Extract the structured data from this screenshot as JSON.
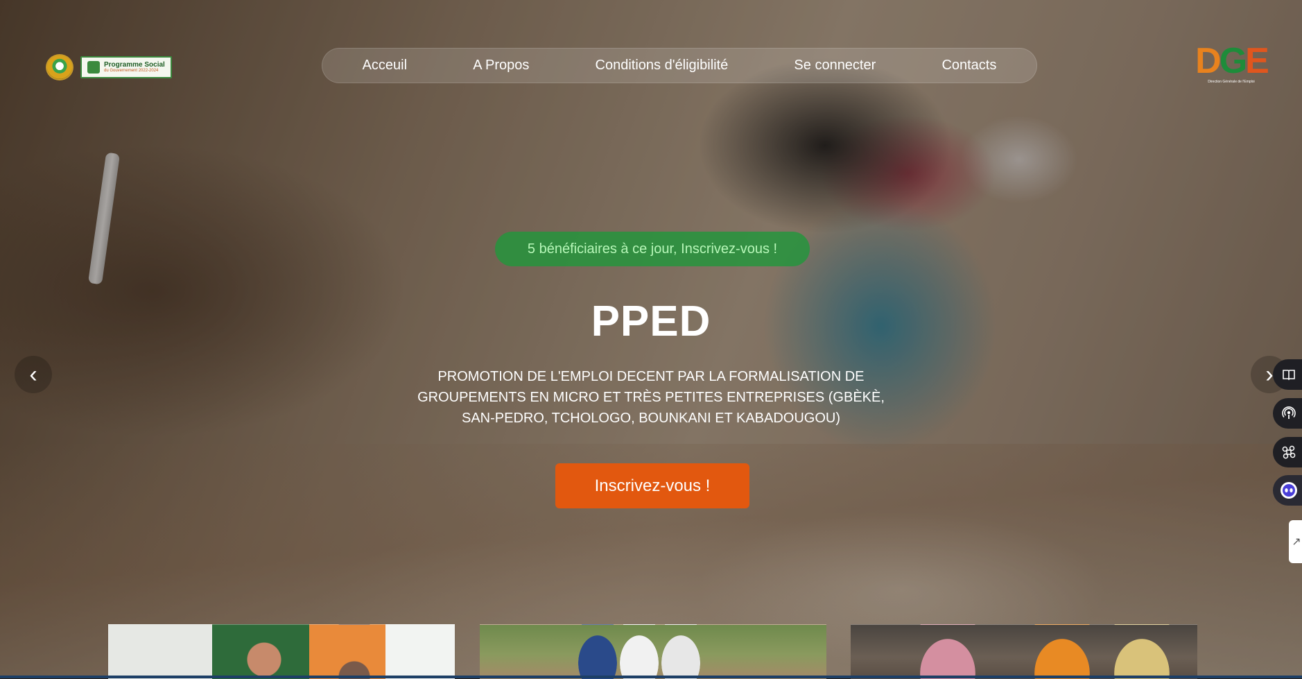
{
  "header": {
    "program_badge": {
      "line1": "Programme Social",
      "line2": "du Gouvernement 2022-2024"
    },
    "nav": [
      {
        "label": "Acceuil"
      },
      {
        "label": "A Propos"
      },
      {
        "label": "Conditions d'éligibilité"
      },
      {
        "label": "Se connecter"
      },
      {
        "label": "Contacts"
      }
    ],
    "right_logo": {
      "letters": "DGE",
      "subtitle": "Direction Générale de l'Emploi"
    }
  },
  "hero": {
    "badge": "5 bénéficiaires à ce jour, Inscrivez-vous !",
    "title": "PPED",
    "subtitle": "PROMOTION DE L'EMPLOI DECENT PAR LA FORMALISATION DE GROUPEMENTS EN MICRO ET TRÈS PETITES ENTREPRISES (GBÈKÈ, SAN-PEDRO, TCHOLOGO, BOUNKANI ET KABADOUGOU)",
    "cta_label": "Inscrivez-vous !",
    "prev_icon": "‹",
    "next_icon": "›"
  },
  "side_toolbar": {
    "icons": [
      "book-icon",
      "podcast-icon",
      "command-icon",
      "chatbot-icon"
    ],
    "tab_icon": "↗"
  },
  "colors": {
    "badge_bg": "#22963c",
    "cta_bg": "#e2580f",
    "accent_bar": "#1d3f66"
  }
}
